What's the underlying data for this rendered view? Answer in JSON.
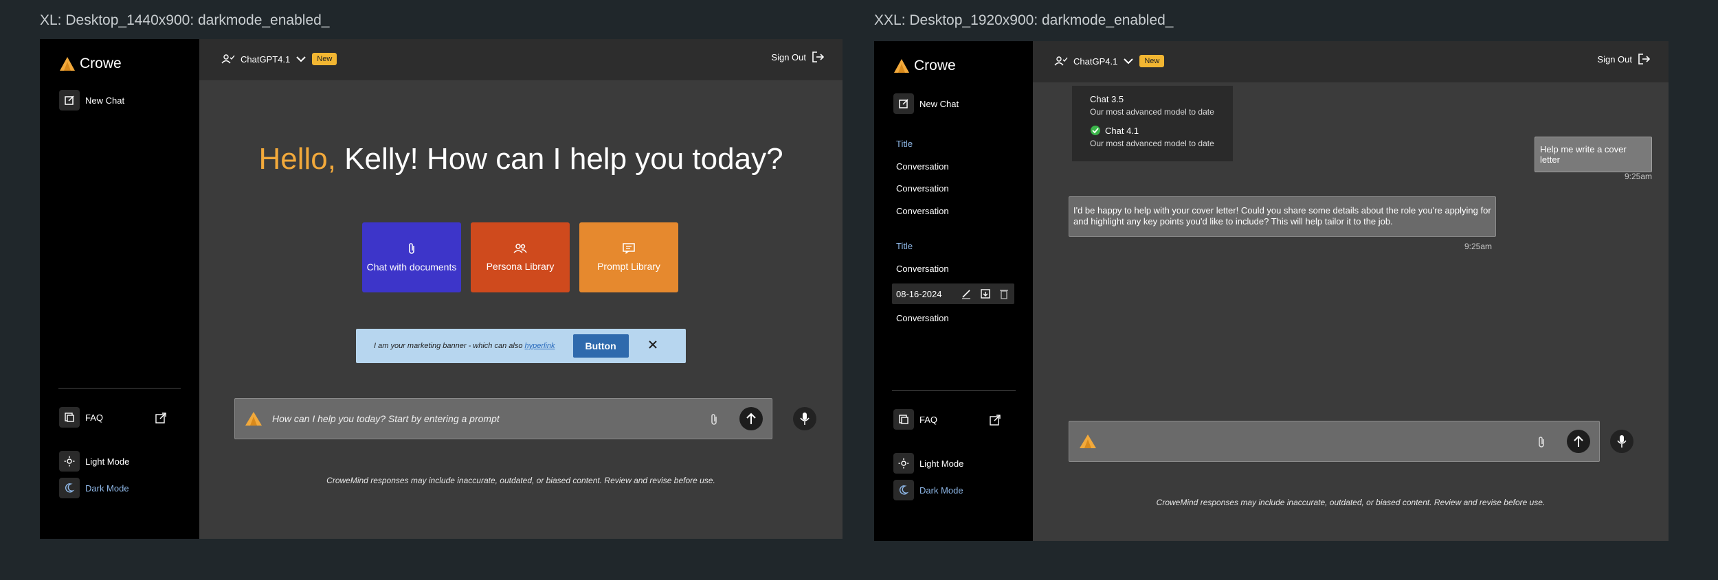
{
  "frames": [
    {
      "label": "XL: Desktop_1440x900: darkmode_enabled_",
      "logo_text": "Crowe",
      "new_chat": "New Chat",
      "model_name": "ChatGPT4.1",
      "new_badge": "New",
      "sign_out": "Sign Out",
      "greeting_hello": "Hello,",
      "greeting_rest": " Kelly! How can I help you today?",
      "tiles": [
        {
          "label": "Chat with documents",
          "color": "#3d35c9",
          "icon": "paperclip-icon"
        },
        {
          "label": "Persona Library",
          "color": "#cf4a1d",
          "icon": "people-icon"
        },
        {
          "label": "Prompt Library",
          "color": "#e6892e",
          "icon": "chat-icon"
        }
      ],
      "banner_text": "I am your marketing banner - which can also ",
      "banner_link": "hyperlink",
      "banner_button": "Button",
      "prompt_placeholder": "How can I help you today? Start by entering a prompt",
      "faq": "FAQ",
      "light_mode": "Light Mode",
      "dark_mode": "Dark Mode",
      "disclaimer": "CroweMind responses may include inaccurate, outdated, or biased content. Review and revise before use."
    },
    {
      "label": "XXL: Desktop_1920x900: darkmode_enabled_",
      "logo_text": "Crowe",
      "new_chat": "New Chat",
      "model_name": "ChatGP4.1",
      "new_badge": "New",
      "sign_out": "Sign Out",
      "history": [
        {
          "text": "Title",
          "type": "title"
        },
        {
          "text": "Conversation",
          "type": "item"
        },
        {
          "text": "Conversation",
          "type": "item"
        },
        {
          "text": "Conversation",
          "type": "item"
        },
        {
          "text": "Title",
          "type": "title"
        },
        {
          "text": "Conversation",
          "type": "item"
        },
        {
          "text": "08-16-2024",
          "type": "selected"
        },
        {
          "text": "Conversation",
          "type": "item"
        }
      ],
      "model_options": [
        {
          "name": "Chat 3.5",
          "desc": "Our most advanced model to date",
          "selected": false
        },
        {
          "name": "Chat 4.1",
          "desc": "Our most advanced model to date",
          "selected": true
        }
      ],
      "user_message": "Help me write a cover letter",
      "user_time": "9:25am",
      "bot_message": "I'd be happy to help with your cover letter! Could you share some details about the role you're applying for and highlight any key points you'd like to include? This will help tailor it to the job.",
      "bot_time": "9:25am",
      "faq": "FAQ",
      "light_mode": "Light Mode",
      "dark_mode": "Dark Mode",
      "disclaimer": "CroweMind responses may include inaccurate, outdated, or biased content. Review and revise before use."
    }
  ],
  "colors": {
    "accent_orange": "#f2a93b",
    "link_blue": "#8fb8e8",
    "badge_yellow": "#f2b632",
    "success_green": "#3bb54a"
  }
}
